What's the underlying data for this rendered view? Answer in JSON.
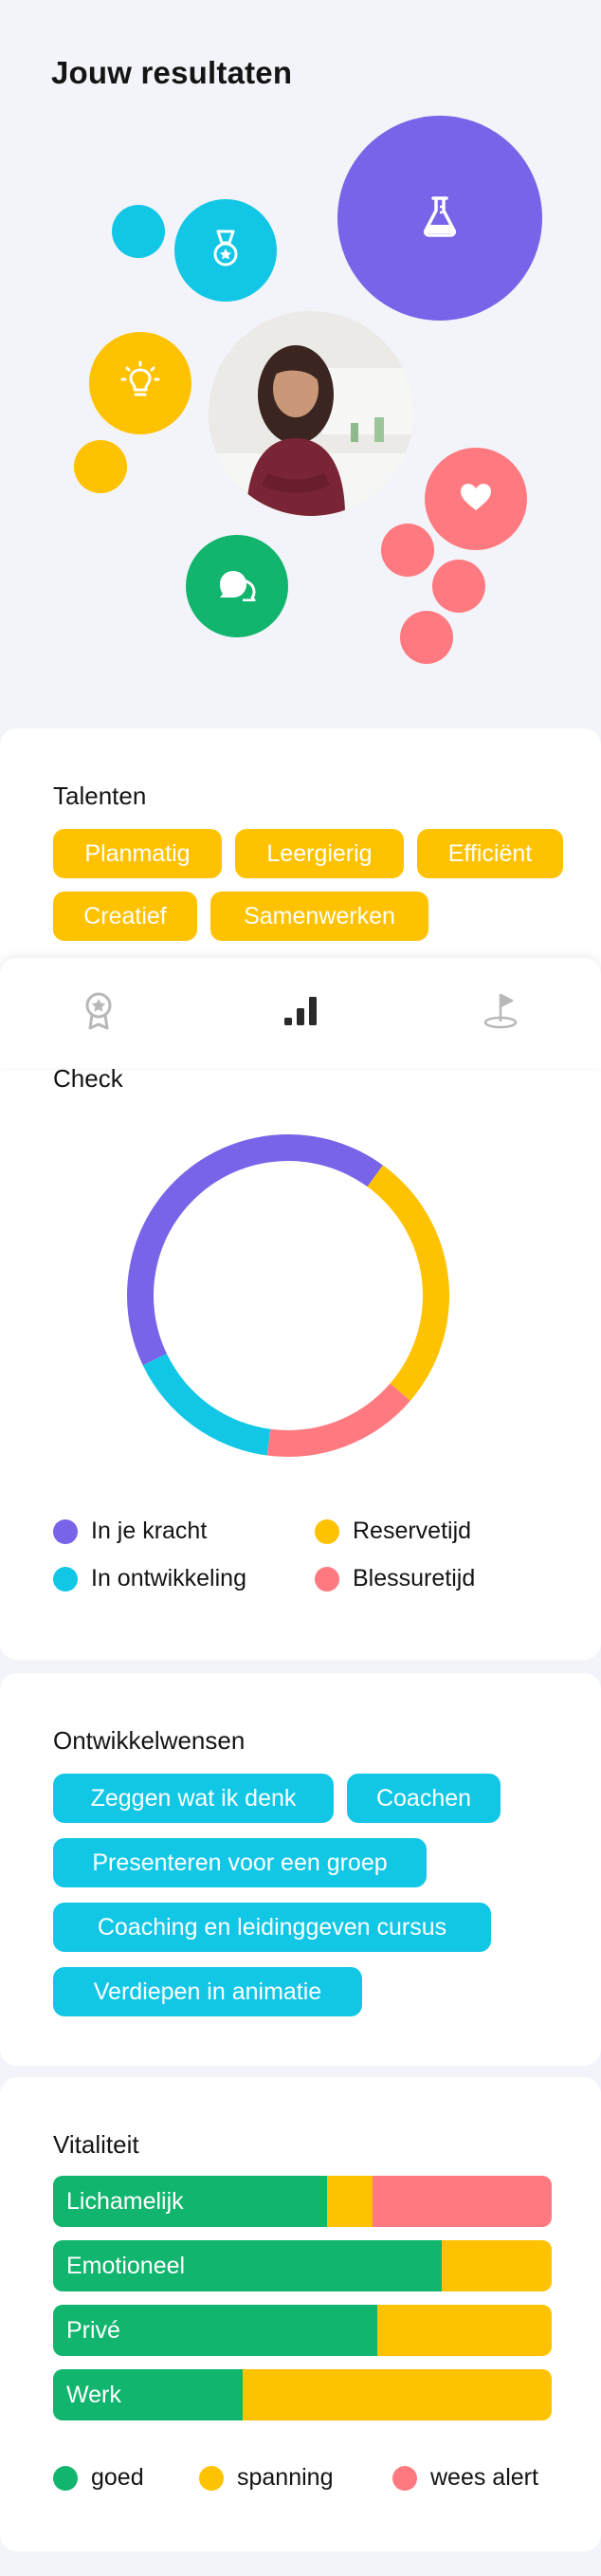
{
  "header": {
    "title": "Jouw resultaten"
  },
  "colors": {
    "purple": "#7764e8",
    "cyan": "#12c7e6",
    "yellow": "#ffc200",
    "pink": "#ff7a80",
    "green": "#11b56e",
    "background": "#f3f4f9"
  },
  "bubbles": {
    "icons": [
      "flask-icon",
      "medal-icon",
      "lightbulb-icon",
      "heart-icon",
      "chat-bubbles-icon"
    ],
    "profile_photo": "profile-photo"
  },
  "talents": {
    "title": "Talenten",
    "chips": [
      "Planmatig",
      "Leergierig",
      "Efficiënt",
      "Creatief",
      "Samenwerken"
    ]
  },
  "tabs": {
    "icons": [
      "badge-icon",
      "signal-bars-icon",
      "flag-icon"
    ],
    "active_index": 1
  },
  "check": {
    "title": "Check",
    "chart_data": {
      "type": "pie",
      "donut": true,
      "slices": [
        {
          "label": "In je kracht",
          "value": 40,
          "color": "#7764e8"
        },
        {
          "label": "Reservetijd",
          "value": 25,
          "color": "#ffc200"
        },
        {
          "label": "Blessuretijd",
          "value": 15,
          "color": "#ff7a80"
        },
        {
          "label": "In ontwikkeling",
          "value": 15,
          "color": "#12c7e6"
        }
      ],
      "legend": [
        "In je kracht",
        "Reservetijd",
        "In ontwikkeling",
        "Blessuretijd"
      ]
    }
  },
  "development": {
    "title": "Ontwikkelwensen",
    "chips": [
      "Zeggen wat ik denk",
      "Coachen",
      "Presenteren voor een groep",
      "Coaching en leidinggeven cursus",
      "Verdiepen in animatie"
    ]
  },
  "vitality": {
    "title": "Vitaliteit",
    "chart_data": {
      "type": "bar",
      "stacked": true,
      "horizontal": true,
      "categories": [
        "Lichamelijk",
        "Emotioneel",
        "Privé",
        "Werk"
      ],
      "series": [
        {
          "name": "goed",
          "color": "#11b56e",
          "values": [
            55,
            78,
            65,
            38
          ]
        },
        {
          "name": "spanning",
          "color": "#ffc200",
          "values": [
            9,
            22,
            35,
            62
          ]
        },
        {
          "name": "wees alert",
          "color": "#ff7a80",
          "values": [
            36,
            0,
            0,
            0
          ]
        }
      ]
    },
    "legend": [
      "goed",
      "spanning",
      "wees alert"
    ]
  }
}
